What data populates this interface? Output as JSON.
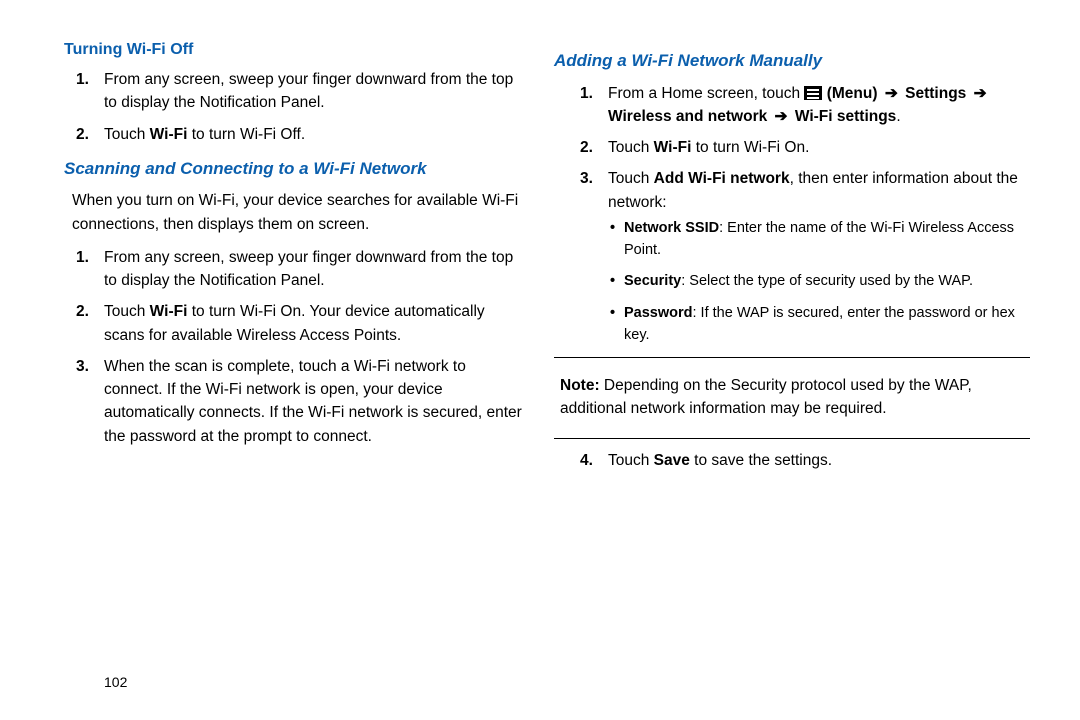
{
  "left": {
    "h1": "Turning Wi-Fi Off",
    "l1a": "From any screen, sweep your finger downward from the top to display the Notification Panel.",
    "l2a": "Touch ",
    "l2b": "Wi-Fi",
    "l2c": " to turn Wi-Fi Off.",
    "h2": "Scanning and Connecting to a Wi-Fi Network",
    "p1": "When you turn on Wi-Fi, your device searches for available Wi-Fi connections, then displays them on screen.",
    "s1": "From any screen, sweep your finger downward from the top to display the Notification Panel.",
    "s2a": "Touch ",
    "s2b": "Wi-Fi",
    "s2c": " to turn Wi-Fi On. Your device automatically scans for available Wireless Access Points.",
    "s3": "When the scan is complete, touch a Wi-Fi network to connect. If the Wi-Fi network is open, your device automatically connects. If the Wi-Fi network is secured, enter the password at the prompt to connect."
  },
  "right": {
    "h1": "Adding a Wi-Fi Network Manually",
    "r1a": "From a Home screen, touch ",
    "r1b": " (Menu) ",
    "r1c": " Settings ",
    "r1d": " Wireless and network ",
    "r1e": " Wi-Fi settings",
    "r2a": "Touch ",
    "r2b": "Wi-Fi",
    "r2c": " to turn Wi-Fi On.",
    "r3a": "Touch ",
    "r3b": "Add Wi-Fi network",
    "r3c": ", then enter information about the network:",
    "b1a": "Network SSID",
    "b1b": ": Enter the name of the Wi-Fi Wireless Access Point.",
    "b2a": "Security",
    "b2b": ": Select the type of security used by the WAP.",
    "b3a": "Password",
    "b3b": ": If the WAP is secured, enter the password or hex key.",
    "noteL": "Note:",
    "noteT": " Depending on the Security protocol used by the WAP, additional network information may be required.",
    "r4a": "Touch ",
    "r4b": "Save",
    "r4c": " to save the settings."
  },
  "pageNumber": "102",
  "arrow": "➔"
}
